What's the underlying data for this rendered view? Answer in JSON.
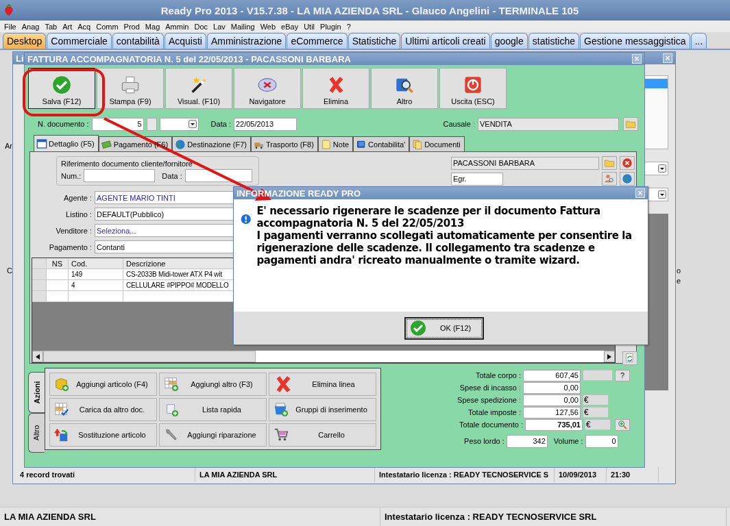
{
  "app_title": "Ready Pro 2013 - V15.7.38 - LA MIA AZIENDA SRL - Glauco Angelini - TERMINALE 105",
  "menu": [
    "File",
    "Anag",
    "Tab",
    "Art",
    "Acq",
    "Comm",
    "Prod",
    "Mag",
    "Ammin",
    "Doc",
    "Lav",
    "Mailing",
    "Web",
    "eBay",
    "Util",
    "Plugin",
    "?"
  ],
  "tabs": [
    {
      "label": "Desktop",
      "selected": true
    },
    {
      "label": "Commerciale",
      "selected": false
    },
    {
      "label": "contabilità",
      "selected": false
    },
    {
      "label": "Acquisti",
      "selected": false
    },
    {
      "label": "Amministrazione",
      "selected": false
    },
    {
      "label": "eCommerce",
      "selected": false
    },
    {
      "label": "Statistiche",
      "selected": false
    },
    {
      "label": "Ultimi articoli creati",
      "selected": false
    },
    {
      "label": "google",
      "selected": false
    },
    {
      "label": "statistiche",
      "selected": false
    },
    {
      "label": "Gestione messaggistica",
      "selected": false
    },
    {
      "label": "...",
      "selected": false
    }
  ],
  "background_window": {
    "title": "Li",
    "fragments": [
      "Ar",
      "C",
      "o",
      "e"
    ],
    "status": [
      "4 record trovati",
      "LA MIA AZIENDA SRL",
      "Intestatario licenza : READY TECNOSERVICE S",
      "10/09/2013",
      "21:30"
    ]
  },
  "invoice_window": {
    "title": "FATTURA ACCOMPAGNATORIA N. 5 del 22/05/2013 - PACASSONI BARBARA",
    "toolbar": [
      {
        "kind": "save",
        "label": "Salva (F12)",
        "selected": true
      },
      {
        "kind": "print",
        "label": "Stampa (F9)",
        "selected": false
      },
      {
        "kind": "wand",
        "label": "Visual. (F10)",
        "selected": false
      },
      {
        "kind": "compass",
        "label": "Navigatore",
        "selected": false
      },
      {
        "kind": "delete",
        "label": "Elimina",
        "selected": false
      },
      {
        "kind": "search",
        "label": "Altro",
        "selected": false
      },
      {
        "kind": "exit",
        "label": "Uscita (ESC)",
        "selected": false
      }
    ],
    "doc_number_label": "N. documento :",
    "doc_number": "5",
    "date_label": "Data :",
    "date": "22/05/2013",
    "causale_label": "Causale :",
    "causale": "VENDITA",
    "tabs": [
      {
        "kind": "calendar",
        "label": "Dettaglio (F5)",
        "selected": true
      },
      {
        "kind": "money",
        "label": "Pagamento (F6)",
        "selected": false
      },
      {
        "kind": "globe",
        "label": "Destinazione (F7)",
        "selected": false
      },
      {
        "kind": "truck",
        "label": "Trasporto (F8)",
        "selected": false
      },
      {
        "kind": "note",
        "label": "Note",
        "selected": false
      },
      {
        "kind": "book",
        "label": "Contabilita'",
        "selected": false
      },
      {
        "kind": "folders",
        "label": "Documenti",
        "selected": false
      }
    ],
    "reference": {
      "legend": "Riferimento documento cliente/fornitore",
      "num_label": "Num.:",
      "date_label": "Data :"
    },
    "customer": {
      "name": "PACASSONI BARBARA",
      "title": "Egr."
    },
    "fields": [
      {
        "label": "Agente :",
        "value": "AGENTE MARIO TINTI",
        "link": true
      },
      {
        "label": "Listino :",
        "value": "DEFAULT(Pubblico)",
        "link": false
      },
      {
        "label": "Venditore :",
        "value": "Seleziona...",
        "link": true
      },
      {
        "label": "Pagamento :",
        "value": "Contanti",
        "link": false
      }
    ],
    "table": {
      "columns": [
        "NS",
        "Cod.",
        "Descrizione"
      ],
      "rows": [
        [
          "",
          "149",
          "CS-2033B Midi-tower ATX P4 wit"
        ],
        [
          "",
          "4",
          "CELLULARE #PIPPO# MODELLO"
        ]
      ]
    },
    "side_tabs": [
      {
        "label": "Azioni",
        "selected": true
      },
      {
        "label": "Altro",
        "selected": false
      }
    ],
    "actions": [
      {
        "kind": "box-add",
        "label": "Aggiungi articolo (F4)"
      },
      {
        "kind": "grid-add",
        "label": "Aggiungi altro (F3)"
      },
      {
        "kind": "delete",
        "label": "Elimina linea"
      },
      {
        "kind": "grid-check",
        "label": "Carica da altro doc."
      },
      {
        "kind": "scroll-add",
        "label": "Lista rapida"
      },
      {
        "kind": "bucket-add",
        "label": "Gruppi di inserimento"
      },
      {
        "kind": "swap",
        "label": "Sostituzione articolo"
      },
      {
        "kind": "wrench",
        "label": "Aggiungi riparazione"
      },
      {
        "kind": "cart",
        "label": "Carrello"
      }
    ],
    "totals": [
      {
        "label": "Totale corpo :",
        "value": "607,45",
        "kind": "help",
        "bold": false
      },
      {
        "label": "Spese di incasso :",
        "value": "0,00",
        "kind": "plain",
        "bold": false
      },
      {
        "label": "Spese spedizione :",
        "value": "0,00",
        "currency": "€",
        "kind": "currency",
        "bold": false
      },
      {
        "label": "Totale imposte :",
        "value": "127,56",
        "currency": "€",
        "kind": "currency",
        "bold": false
      },
      {
        "label": "Totale documento :",
        "value": "735,01",
        "currency": "€",
        "kind": "zoom",
        "bold": true
      }
    ],
    "help_label": "?",
    "weight_label": "Peso lordo :",
    "weight": "342",
    "volume_label": "Volume :",
    "volume": "0"
  },
  "dialog": {
    "title": "INFORMAZIONE READY PRO",
    "close": "×",
    "message": [
      "E' necessario rigenerare le scadenze per il documento Fattura accompagnatoria N. 5 del 22/05/2013",
      "I pagamenti verranno scollegati automaticamente per consentire la rigenerazione delle scadenze. Il collegamento tra scadenze e pagamenti andra' ricreato manualmente o tramite wizard."
    ],
    "ok": "OK (F12)"
  },
  "window_close": "×",
  "status_bar": [
    "LA MIA AZIENDA SRL",
    "Intestatario licenza : READY TECNOSERVICE SRL"
  ]
}
